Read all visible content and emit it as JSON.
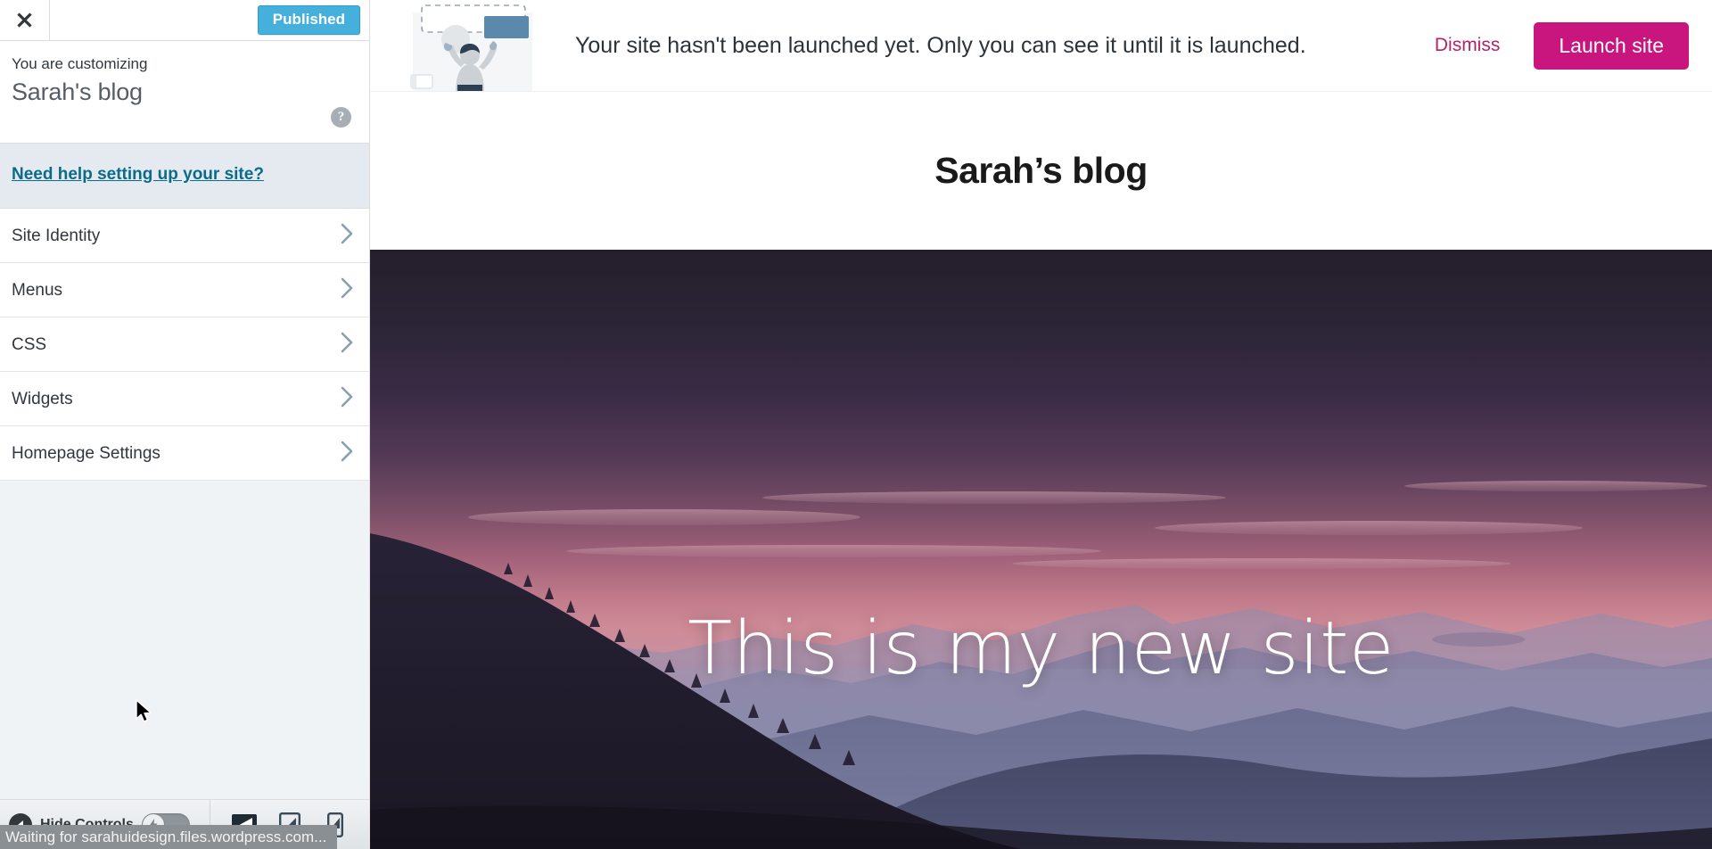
{
  "customizer": {
    "close_label": "Close customizer",
    "publish_button": "Published",
    "subtitle": "You are customizing",
    "site_name": "Sarah's blog",
    "help_icon_glyph": "?",
    "help_banner_link": "Need help setting up your site?",
    "sections": [
      {
        "label": "Site Identity"
      },
      {
        "label": "Menus"
      },
      {
        "label": "CSS"
      },
      {
        "label": "Widgets"
      },
      {
        "label": "Homepage Settings"
      }
    ],
    "bottom_bar": {
      "hide_controls_label": "Hide Controls",
      "devices": [
        {
          "name": "desktop",
          "label": "Enter desktop preview mode",
          "active": true
        },
        {
          "name": "tablet",
          "label": "Enter tablet preview mode",
          "active": false
        },
        {
          "name": "mobile",
          "label": "Enter mobile preview mode",
          "active": false
        }
      ]
    }
  },
  "status_bar": {
    "text": "Waiting for sarahuidesign.files.wordpress.com..."
  },
  "launch_notice": {
    "message": "Your site hasn't been launched yet. Only you can see it until it is launched.",
    "dismiss_label": "Dismiss",
    "launch_label": "Launch site",
    "illustration_name": "person-placing-block-illustration"
  },
  "preview": {
    "site_title": "Sarah’s blog",
    "hero_caption": "This is my new site",
    "hero_image_description": "Layered mountain ridges at dusk under a pink and purple sky"
  },
  "colors": {
    "published_blue": "#46b0dd",
    "launch_magenta": "#c9157e",
    "dismiss_magenta": "#b7236b",
    "help_link_teal": "#0a6b8a",
    "panel_bg": "#eff3f6",
    "help_banner_bg": "#e4eaf0",
    "status_bar_bg": "#8a8f94"
  }
}
